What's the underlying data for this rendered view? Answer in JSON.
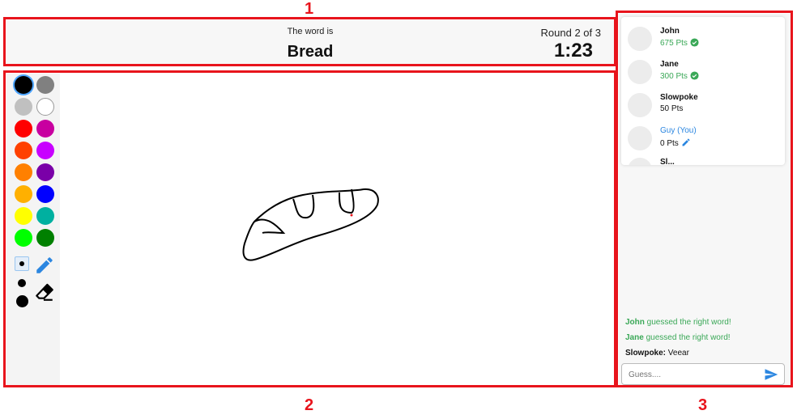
{
  "annotations": [
    "1",
    "2",
    "3"
  ],
  "header": {
    "word_caption": "The word is",
    "word": "Bread",
    "round": "Round 2 of 3",
    "timer": "1:23"
  },
  "palette": [
    "#000000",
    "#808080",
    "#c0c0c0",
    "#ffffff",
    "#ff0000",
    "#c800a0",
    "#ff4000",
    "#c800ff",
    "#ff8000",
    "#7a00a8",
    "#ffb000",
    "#0000ff",
    "#ffff00",
    "#00b0a0",
    "#00ff00",
    "#008000"
  ],
  "selected_color": "#000000",
  "tools": {
    "pencil_icon": "pencil-icon",
    "eraser_icon": "eraser-icon",
    "pencil_color": "#2b86e0"
  },
  "players": [
    {
      "name": "John",
      "score": "675 Pts",
      "status": "guessed"
    },
    {
      "name": "Jane",
      "score": "300 Pts",
      "status": "guessed"
    },
    {
      "name": "Slowpoke",
      "score": "50 Pts",
      "status": ""
    },
    {
      "name": "Guy (You)",
      "score": "0 Pts",
      "status": "drawing"
    },
    {
      "name": "Sl...",
      "score": "",
      "status": ""
    }
  ],
  "chat": [
    {
      "user": "John",
      "text": "guessed the right word!"
    },
    {
      "user": "Jane",
      "text": "guessed the right word!"
    },
    {
      "user": "Slowpoke:",
      "text": "Veear"
    }
  ],
  "guess": {
    "placeholder": "Guess....",
    "value": ""
  },
  "colors": {
    "accent": "#2b86e0",
    "success": "#3aa857",
    "annotation": "#e8141c"
  }
}
